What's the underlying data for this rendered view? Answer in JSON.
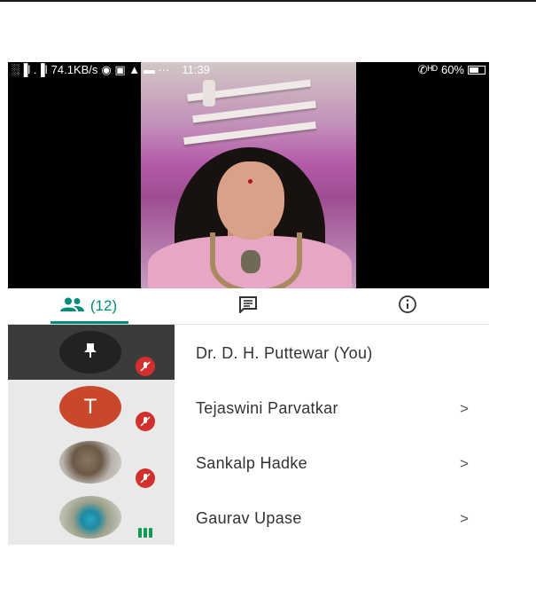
{
  "status_bar": {
    "signal": "░▐l .▐l",
    "speed": "74.1KB/s",
    "icons": "◉ ▣ ▲ ▬ ···",
    "time": "11:39",
    "call_icon": "✆ᴴᴰ",
    "battery": "60%"
  },
  "tabs": [
    {
      "icon": "people-icon",
      "label": "(12)",
      "selected": true
    },
    {
      "icon": "chat-icon",
      "label": ""
    },
    {
      "icon": "info-icon",
      "label": ""
    }
  ],
  "participants": [
    {
      "name": "Dr. D. H. Puttewar (You)",
      "avatar": "pin-icon",
      "muted": true,
      "has_chevron": false
    },
    {
      "name": "Tejaswini Parvatkar",
      "avatar_letter": "T",
      "muted": true,
      "has_chevron": true
    },
    {
      "name": "Sankalp Hadke",
      "avatar": "photo",
      "muted": true,
      "has_chevron": true
    },
    {
      "name": "Gaurav Upase",
      "avatar": "photo",
      "muted": false,
      "speaking": true,
      "has_chevron": true
    }
  ],
  "chevron": ">",
  "colors": {
    "accent": "#008c7a",
    "mute": "#d32f2f",
    "speaking": "#0f9d58"
  }
}
